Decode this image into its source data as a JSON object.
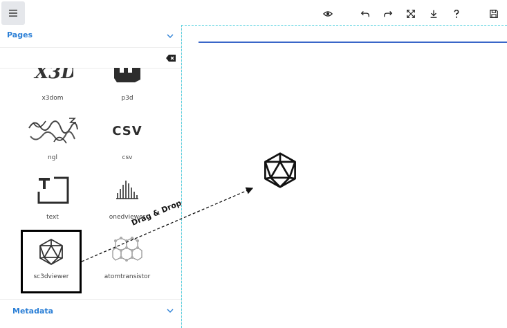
{
  "toolbar": {
    "icons": [
      "menu-icon",
      "eye-icon",
      "undo-icon",
      "redo-icon",
      "fullscreen-icon",
      "download-icon",
      "help-icon",
      "save-icon"
    ]
  },
  "sidebar": {
    "pages_title": "Pages",
    "search": {
      "value": "",
      "placeholder": ""
    },
    "tiles": [
      {
        "label": "x3dom",
        "icon": "x3d-logo"
      },
      {
        "label": "p3d",
        "icon": "p3d-logo"
      },
      {
        "label": "ngl",
        "icon": "ngl-logo"
      },
      {
        "label": "csv",
        "icon": "csv-logo",
        "logo_text": "CSV"
      },
      {
        "label": "text",
        "icon": "text-icon"
      },
      {
        "label": "onedviewer",
        "icon": "spectrum-icon"
      },
      {
        "label": "sc3dviewer",
        "icon": "icosahedron-icon"
      },
      {
        "label": "atomtransistor",
        "icon": "graphene-icon"
      }
    ],
    "metadata_title": "Metadata"
  },
  "canvas": {
    "drag_hint": "Drag & Drop"
  }
}
